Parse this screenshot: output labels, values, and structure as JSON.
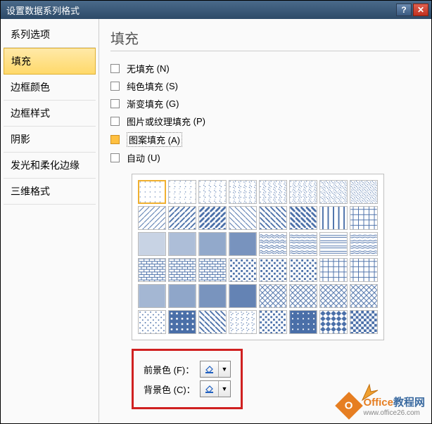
{
  "title": "设置数据系列格式",
  "sidebar": {
    "items": [
      "系列选项",
      "填充",
      "边框颜色",
      "边框样式",
      "阴影",
      "发光和柔化边缘",
      "三维格式"
    ],
    "active_index": 1
  },
  "main": {
    "heading": "填充",
    "fill_options": [
      {
        "label": "无填充",
        "accel": "(N)"
      },
      {
        "label": "纯色填充",
        "accel": "(S)"
      },
      {
        "label": "渐变填充",
        "accel": "(G)"
      },
      {
        "label": "图片或纹理填充",
        "accel": "(P)"
      },
      {
        "label": "图案填充",
        "accel": "(A)"
      },
      {
        "label": "自动",
        "accel": "(U)"
      }
    ],
    "selected_option_index": 4,
    "foreground_label": "前景色",
    "foreground_accel": "(F)：",
    "background_label": "背景色",
    "background_accel": "(C)：",
    "selected_pattern_index": 0
  },
  "watermark": {
    "brand1": "Office",
    "brand2": "教程网",
    "url": "www.office26.com"
  }
}
